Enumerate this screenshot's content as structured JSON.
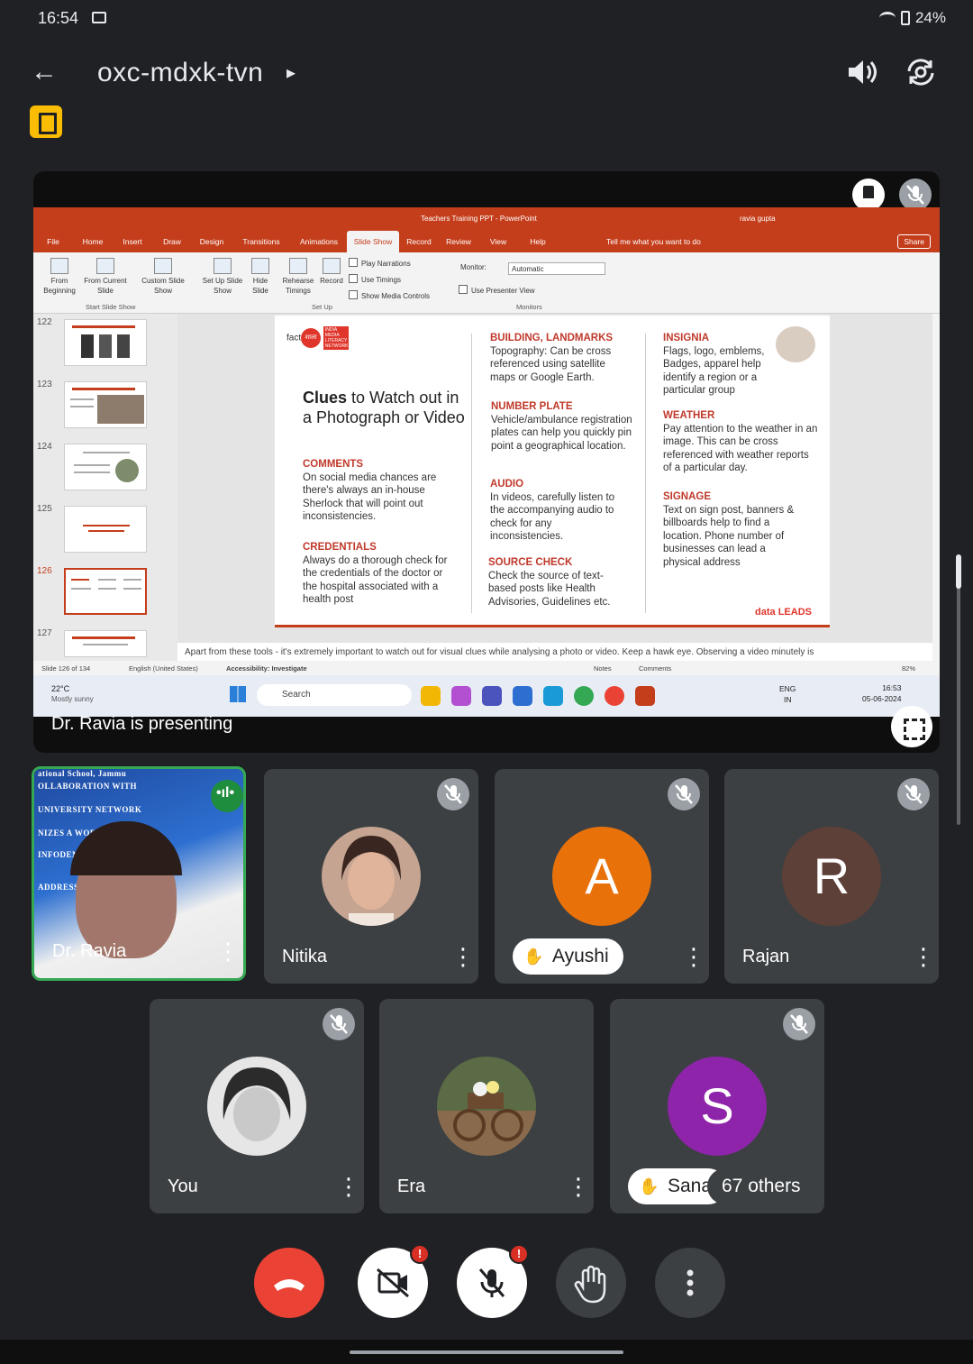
{
  "status_bar": {
    "time": "16:54",
    "battery": "24%"
  },
  "header": {
    "meeting_code": "oxc-mdxk-tvn",
    "chevron": "▸"
  },
  "presentation": {
    "presenting_label": "Dr. Ravia is presenting",
    "ppt": {
      "window_title": "Teachers Training PPT  -  PowerPoint",
      "user": "ravia gupta",
      "tabs": [
        "File",
        "Home",
        "Insert",
        "Draw",
        "Design",
        "Transitions",
        "Animations",
        "Slide Show",
        "Record",
        "Review",
        "View",
        "Help"
      ],
      "tell_me": "Tell me what you want to do",
      "share": "Share",
      "ribbon": {
        "from_beginning": "From Beginning",
        "from_current": "From Current Slide",
        "custom_show": "Custom Slide Show",
        "group_start": "Start Slide Show",
        "setup_show": "Set Up Slide Show",
        "hide_slide": "Hide Slide",
        "rehearse": "Rehearse Timings",
        "record": "Record",
        "play_narrations": "Play Narrations",
        "use_timings": "Use Timings",
        "show_media": "Show Media Controls",
        "group_setup": "Set Up",
        "monitor_label": "Monitor:",
        "monitor_value": "Automatic",
        "presenter_view": "Use Presenter View",
        "group_monitors": "Monitors"
      },
      "thumbnails": [
        "122",
        "123",
        "124",
        "125",
        "126",
        "127"
      ],
      "slide": {
        "logo": "fact",
        "logo_badge": "शाला",
        "logo_tag": "INDIA MEDIA LITERACY NETWORK",
        "title_bold": "Clues",
        "title_rest": " to Watch out in a Photograph or Video",
        "blocks": [
          {
            "head": "COMMENTS",
            "body": "On social media chances are there's always an in-house Sherlock that will point out inconsistencies."
          },
          {
            "head": "CREDENTIALS",
            "body": "Always do a thorough check for the credentials of the doctor or the hospital associated with a health post"
          },
          {
            "head": "BUILDING, LANDMARKS",
            "body": "Topography: Can be cross referenced using satellite maps or Google Earth."
          },
          {
            "head": "NUMBER PLATE",
            "body": "Vehicle/ambulance registration plates can help you quickly pin point a geographical location."
          },
          {
            "head": "AUDIO",
            "body": "In videos, carefully listen to the accompanying audio to check for any inconsistencies."
          },
          {
            "head": "SOURCE CHECK",
            "body": "Check the source of text-based posts like Health Advisories, Guidelines etc."
          },
          {
            "head": "INSIGNIA",
            "body": "Flags, logo, emblems, Badges, apparel help identify a region or a particular group"
          },
          {
            "head": "WEATHER",
            "body": "Pay attention to the weather in an image. This can be cross referenced with weather reports of a particular day."
          },
          {
            "head": "SIGNAGE",
            "body": "Text on sign post, banners & billboards help to find a location. Phone number of businesses can lead a physical address"
          }
        ],
        "footer_logo": "data LEADS"
      },
      "notes": "Apart from these tools - it's extremely important to watch out for visual clues while analysing a photo or video. Keep a hawk eye. Observing a video minutely is",
      "status": {
        "slide_of": "Slide 126 of 134",
        "language": "English (United States)",
        "accessibility": "Accessibility: Investigate",
        "notes": "Notes",
        "comments": "Comments",
        "zoom": "82%"
      },
      "taskbar": {
        "temp": "22°C",
        "weather": "Mostly sunny",
        "search": "Search",
        "lang": "ENG",
        "region": "IN",
        "time": "16:53",
        "date": "05-06-2024"
      }
    }
  },
  "participants": [
    {
      "name": "Dr. Ravia",
      "speaking": true,
      "bg_lines": [
        "ational School, Jammu",
        "OLLABORATION WITH",
        "UNIVERSITY NETWORK",
        "NIZES A WORKSHOP ON",
        "INFODEMIC POST IN",
        "ADDRESS MEDIA"
      ]
    },
    {
      "name": "Nitika",
      "muted": true
    },
    {
      "name": "Ayushi",
      "muted": true,
      "hand_raised": true,
      "initial": "A",
      "color": "#e8710a"
    },
    {
      "name": "Rajan",
      "muted": true,
      "initial": "R",
      "color": "#5d4037"
    },
    {
      "name": "You",
      "muted": true
    },
    {
      "name": "Era"
    },
    {
      "name": "Sana",
      "muted": true,
      "hand_raised": true,
      "initial": "S",
      "color": "#8e24aa",
      "others": "67 others"
    }
  ],
  "controls": {
    "alert_badge": "!"
  }
}
